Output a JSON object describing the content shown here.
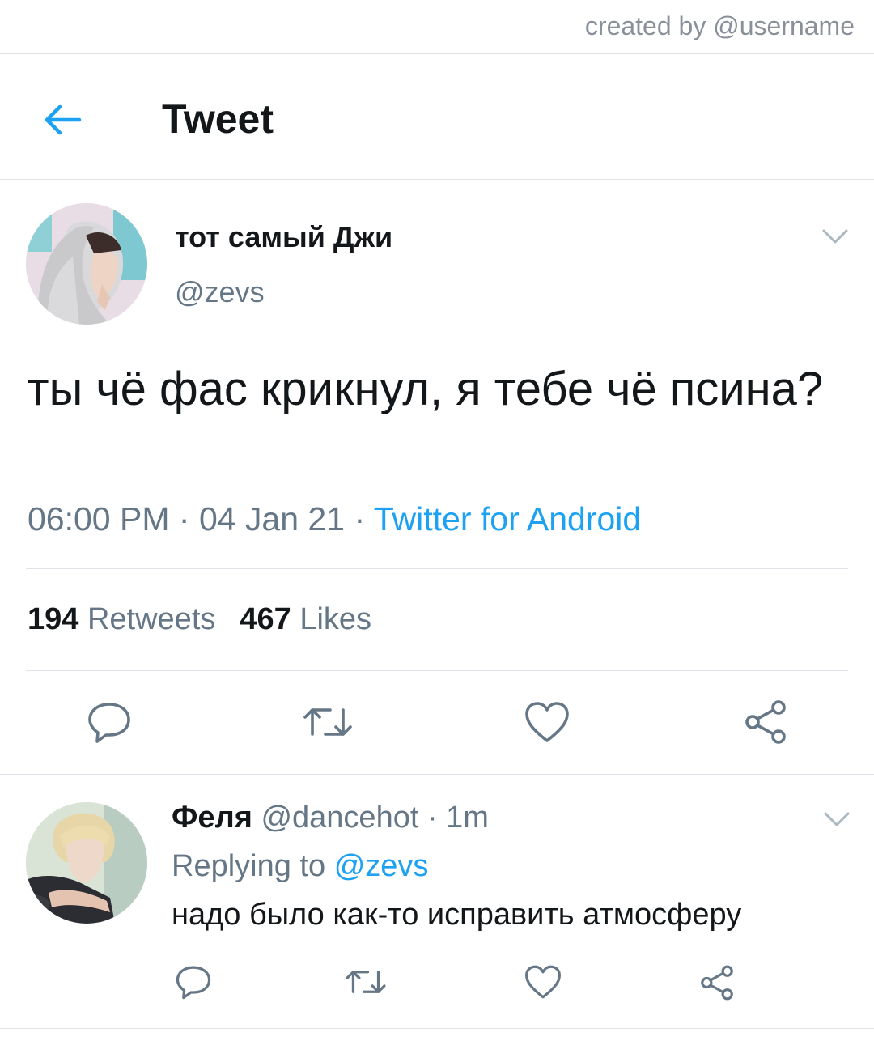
{
  "watermark": "created by @username",
  "header": {
    "title": "Tweet",
    "back_icon": "arrow-left-icon"
  },
  "tweet": {
    "display_name": "тот самый Джи",
    "handle": "@zevs",
    "text": "ты чё фас крикнул, я тебе чё псина?",
    "time": "06:00 PM",
    "date": "04 Jan 21",
    "source": "Twitter for Android",
    "retweets_count": "194",
    "retweets_label": "Retweets",
    "likes_count": "467",
    "likes_label": "Likes"
  },
  "reply": {
    "display_name": "Феля",
    "handle": "@dancehot",
    "time": "1m",
    "replying_label": "Replying to",
    "replying_to": "@zevs",
    "text": "надо было как-то исправить атмосферу"
  },
  "actions": [
    "reply-icon",
    "retweet-icon",
    "like-icon",
    "share-icon"
  ],
  "colors": {
    "accent": "#1da1f2",
    "secondary_text": "#657786",
    "primary_text": "#14171a",
    "divider": "#dfe3e7",
    "icon": "#657786"
  }
}
